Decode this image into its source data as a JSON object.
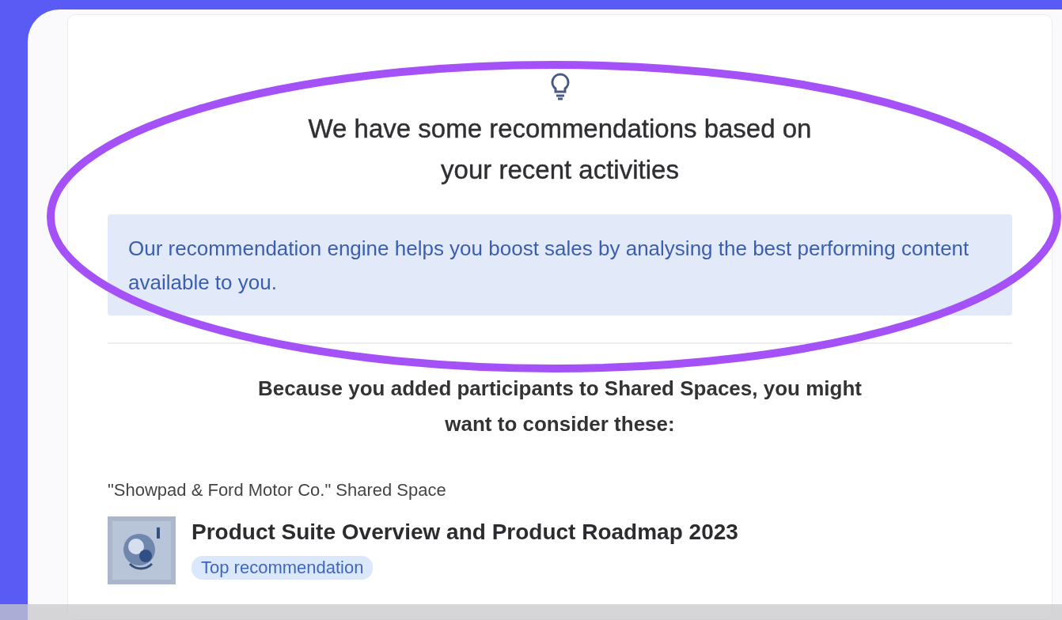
{
  "heading": "We have some recommendations based on your recent activities",
  "info": "Our recommendation engine helps you boost sales by analysing the best performing content available to you.",
  "reason": "Because you added participants to Shared Spaces, you might want to consider these:",
  "groups": [
    {
      "label": "\"Showpad & Ford Motor Co.\" Shared Space",
      "items": [
        {
          "title": "Product Suite Overview and Product Roadmap 2023",
          "badge": "Top recommendation"
        }
      ]
    }
  ]
}
